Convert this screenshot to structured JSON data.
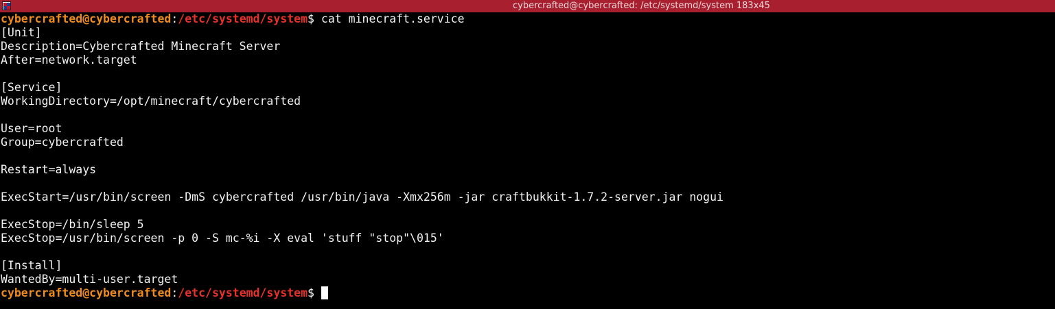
{
  "window": {
    "title": "cybercrafted@cybercrafted: /etc/systemd/system 183x45",
    "titlebar_color": "#a8202f",
    "icon": "terminal-app-icon"
  },
  "terminal": {
    "prompt_user": "cybercrafted@cybercrafted",
    "prompt_sep": ":",
    "prompt_path": "/etc/systemd/system",
    "prompt_sign": "$ ",
    "command": "cat minecraft.service",
    "output": [
      "[Unit]",
      "Description=Cybercrafted Minecraft Server",
      "After=network.target",
      "",
      "[Service]",
      "WorkingDirectory=/opt/minecraft/cybercrafted",
      "",
      "User=root",
      "Group=cybercrafted",
      "",
      "Restart=always",
      "",
      "ExecStart=/usr/bin/screen -DmS cybercrafted /usr/bin/java -Xmx256m -jar craftbukkit-1.7.2-server.jar nogui",
      "",
      "ExecStop=/bin/sleep 5",
      "ExecStop=/usr/bin/screen -p 0 -S mc-%i -X eval 'stuff \"stop\"\\015'",
      "",
      "[Install]",
      "WantedBy=multi-user.target"
    ],
    "colors": {
      "user": "#f08c1e",
      "path": "#e8302a",
      "text": "#f2f2f2",
      "background": "#000000"
    }
  }
}
